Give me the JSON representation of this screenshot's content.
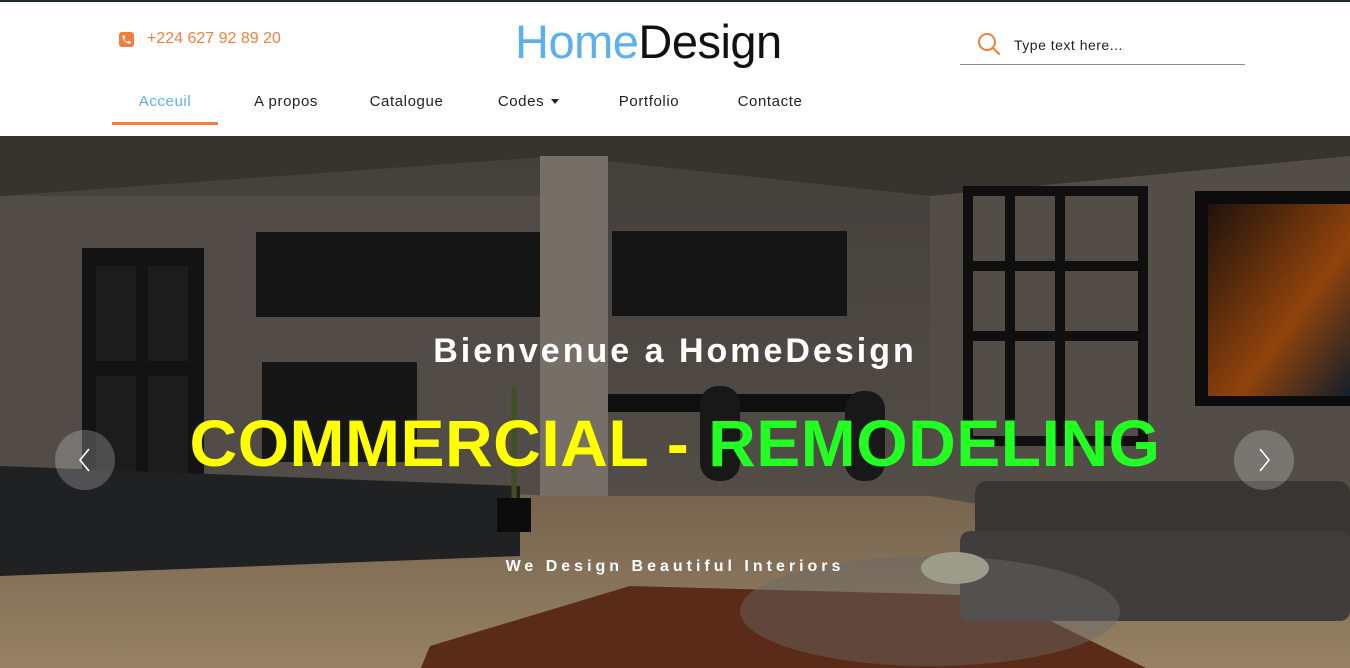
{
  "header": {
    "phone": "+224 627 92 89 20",
    "logo_part1": "Home",
    "logo_part2": "Design",
    "search_placeholder": "Type text here..."
  },
  "nav": {
    "items": [
      {
        "label": "Acceuil",
        "active": true
      },
      {
        "label": "A propos"
      },
      {
        "label": "Catalogue"
      },
      {
        "label": "Codes"
      },
      {
        "label": "Portfolio"
      },
      {
        "label": "Contacte"
      }
    ]
  },
  "hero": {
    "welcome": "Bienvenue a HomeDesign",
    "headline_part1": "COMMERCIAL -",
    "headline_part2": "REMODELING",
    "subtitle": "We Design Beautiful Interiors"
  },
  "colors": {
    "accent_orange": "#f07f3d",
    "logo_blue": "#5bb0ef",
    "headline_yellow": "#ffff00",
    "headline_green": "#22ff22"
  },
  "icons": {
    "phone": "phone-icon",
    "search": "search-icon",
    "prev": "chevron-left-icon",
    "next": "chevron-right-icon",
    "dropdown": "caret-down-icon"
  }
}
